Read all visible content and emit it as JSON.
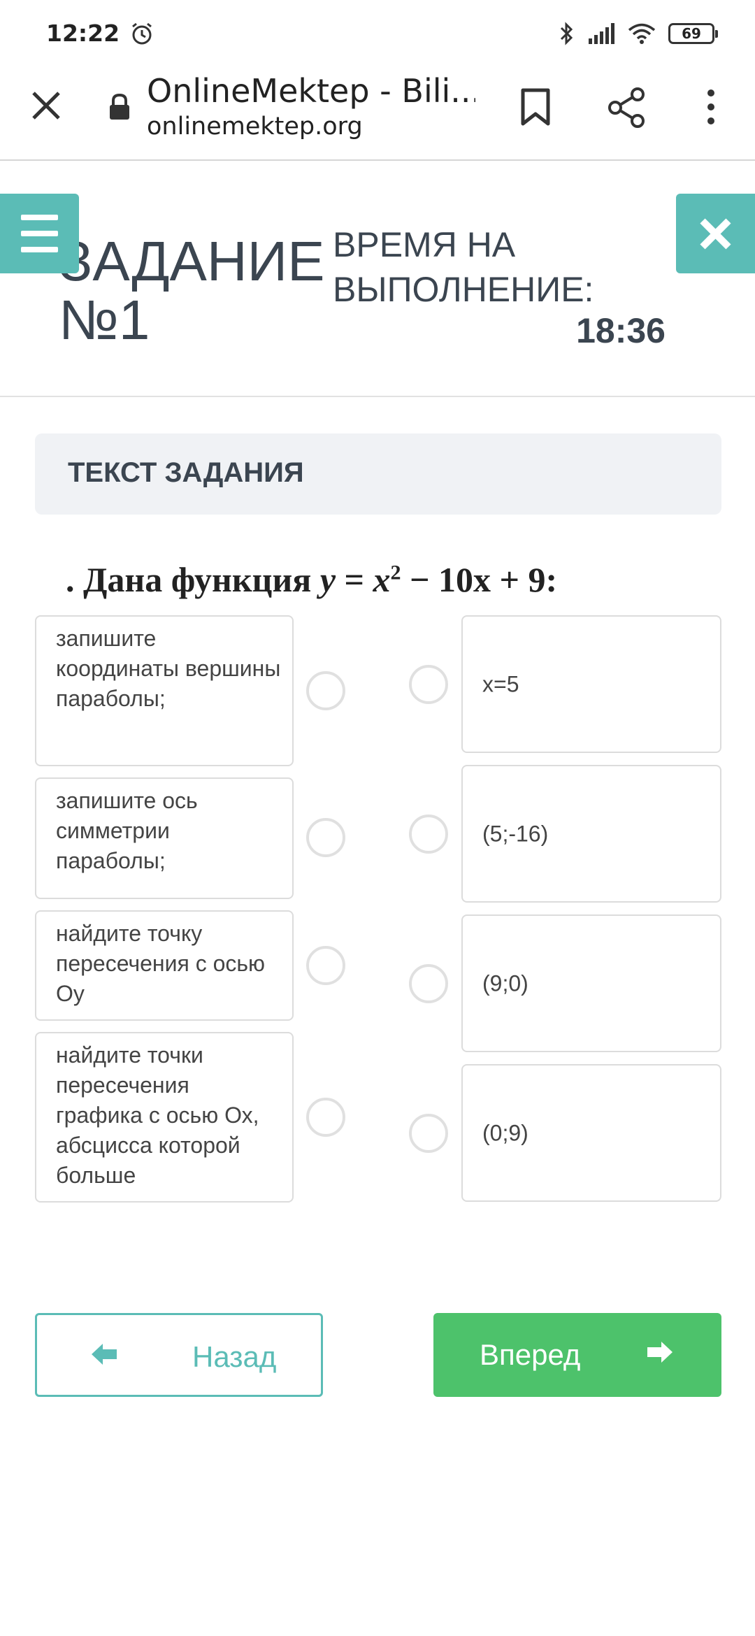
{
  "status_bar": {
    "time": "12:22",
    "battery": "69"
  },
  "browser": {
    "title": "OnlineMektep - Bili...",
    "url": "onlinemektep.org"
  },
  "header": {
    "task_title": "ЗАДАНИЕ №1",
    "time_label": "ВРЕМЯ НА ВЫПОЛНЕНИЕ:",
    "time_value": "18:36"
  },
  "task_text_label": "ТЕКСТ ЗАДАНИЯ",
  "problem": {
    "prefix": ". Дана функция ",
    "var_y": "y",
    "eq": " = ",
    "var_x": "x",
    "exp": "2",
    "rest": " − 10x + 9:"
  },
  "left_items": [
    "запишите координаты вершины параболы;",
    "запишите ось симметрии параболы;",
    "найдите точку пересечения с осью Оу",
    "найдите точки пересечения графика с осью Ох, абсцисса которой больше"
  ],
  "right_items": [
    "x=5",
    "(5;-16)",
    "(9;0)",
    "(0;9)"
  ],
  "nav": {
    "back": "Назад",
    "next": "Вперед"
  },
  "colors": {
    "accent": "#5bbcb6",
    "next_button": "#4dc26b",
    "text": "#3b4550"
  }
}
